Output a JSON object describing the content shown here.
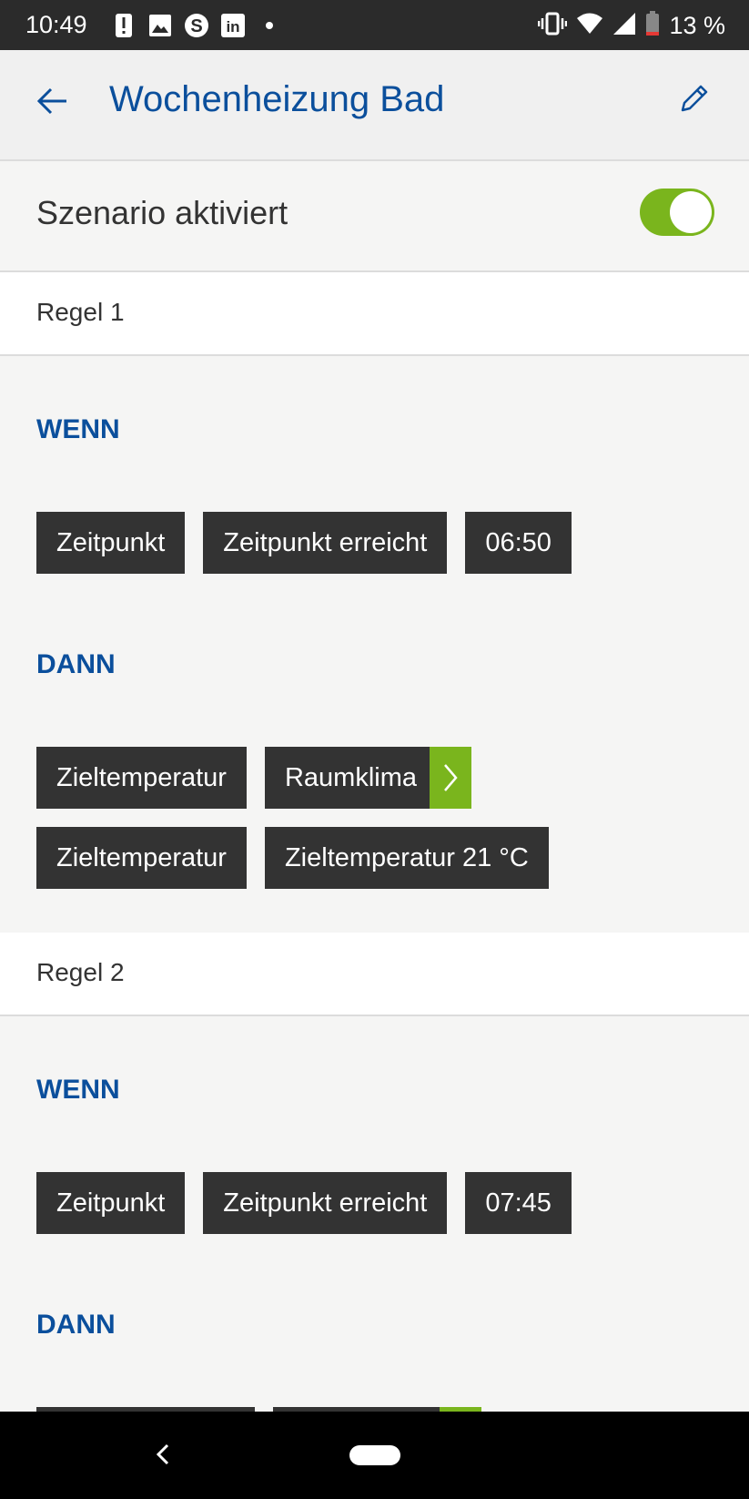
{
  "status_bar": {
    "time": "10:49",
    "battery": "13 %",
    "notification_icons": [
      "alert-icon",
      "image-icon",
      "skype-icon",
      "linkedin-icon",
      "dot-icon"
    ]
  },
  "app_bar": {
    "title": "Wochenheizung Bad"
  },
  "toggle": {
    "label": "Szenario aktiviert",
    "state": "on",
    "color": "#7ab51d"
  },
  "rules": [
    {
      "title": "Regel 1",
      "if_label": "WENN",
      "if_chips": [
        "Zeitpunkt",
        "Zeitpunkt erreicht",
        "06:50"
      ],
      "then_label": "DANN",
      "then_rows": [
        [
          "Zieltemperatur",
          "Raumklima"
        ],
        [
          "Zieltemperatur",
          "Zieltemperatur 21 °C"
        ]
      ]
    },
    {
      "title": "Regel 2",
      "if_label": "WENN",
      "if_chips": [
        "Zeitpunkt",
        "Zeitpunkt erreicht",
        "07:45"
      ],
      "then_label": "DANN"
    }
  ],
  "colors": {
    "accent": "#0b4f9c",
    "chip": "#333333",
    "green": "#7ab51d"
  }
}
